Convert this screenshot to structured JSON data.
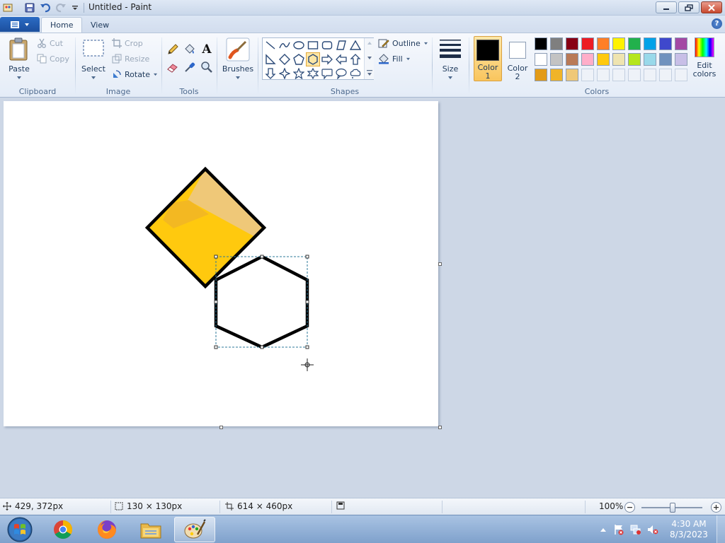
{
  "window": {
    "title": "Untitled - Paint"
  },
  "tabs": [
    {
      "label": "Home",
      "active": true
    },
    {
      "label": "View",
      "active": false
    }
  ],
  "clipboard": {
    "paste_label": "Paste",
    "cut_label": "Cut",
    "copy_label": "Copy",
    "group_label": "Clipboard"
  },
  "image": {
    "select_label": "Select",
    "crop_label": "Crop",
    "resize_label": "Resize",
    "rotate_label": "Rotate",
    "group_label": "Image"
  },
  "tools": {
    "group_label": "Tools",
    "items": [
      "pencil-icon",
      "fill-bucket-icon",
      "text-icon",
      "eraser-icon",
      "color-picker-icon",
      "magnifier-icon"
    ]
  },
  "brushes": {
    "label": "Brushes"
  },
  "shapes": {
    "group_label": "Shapes",
    "outline_label": "Outline",
    "fill_label": "Fill",
    "selected": "hexagon",
    "items": [
      "line",
      "curve",
      "oval",
      "rectangle",
      "rounded-rectangle",
      "polygon",
      "triangle",
      "right-triangle",
      "diamond",
      "pentagon",
      "hexagon",
      "right-arrow",
      "left-arrow",
      "up-arrow",
      "down-arrow",
      "four-point-star",
      "five-point-star",
      "six-point-star",
      "rounded-callout",
      "oval-callout",
      "cloud-callout"
    ]
  },
  "size": {
    "label": "Size"
  },
  "colors": {
    "group_label": "Colors",
    "color1_label": "Color",
    "color1_num": "1",
    "color2_label": "Color",
    "color2_num": "2",
    "color1": "#000000",
    "color2": "#ffffff",
    "edit_label": "Edit",
    "edit_label2": "colors",
    "palette_row1": [
      "#000000",
      "#7f7f7f",
      "#880015",
      "#ed1c24",
      "#ff7f27",
      "#fff200",
      "#22b14c",
      "#00a2e8",
      "#3f48cc",
      "#a349a4"
    ],
    "palette_row2": [
      "#ffffff",
      "#c3c3c3",
      "#b97a57",
      "#ffaec9",
      "#ffc90e",
      "#efe4b0",
      "#b5e61d",
      "#99d9ea",
      "#7092be",
      "#c8bfe7"
    ],
    "palette_row3": [
      "#e39b17",
      "#f0b428",
      "#efc878",
      "#eef2f8",
      "#eef2f8",
      "#eef2f8",
      "#eef2f8",
      "#eef2f8",
      "#eef2f8",
      "#eef2f8"
    ]
  },
  "canvas": {
    "diamond_fill": "#ffc90e",
    "diamond_highlight": "#efc878",
    "stroke": "#000000"
  },
  "status": {
    "cursor_pos": "429, 372px",
    "selection_size": "130 × 130px",
    "image_size": "614 × 460px",
    "zoom": "100%"
  },
  "taskbar": {
    "apps": [
      "chrome-icon",
      "firefox-icon",
      "file-explorer-icon",
      "paint-icon"
    ],
    "time": "4:30 AM",
    "date": "8/3/2023"
  }
}
